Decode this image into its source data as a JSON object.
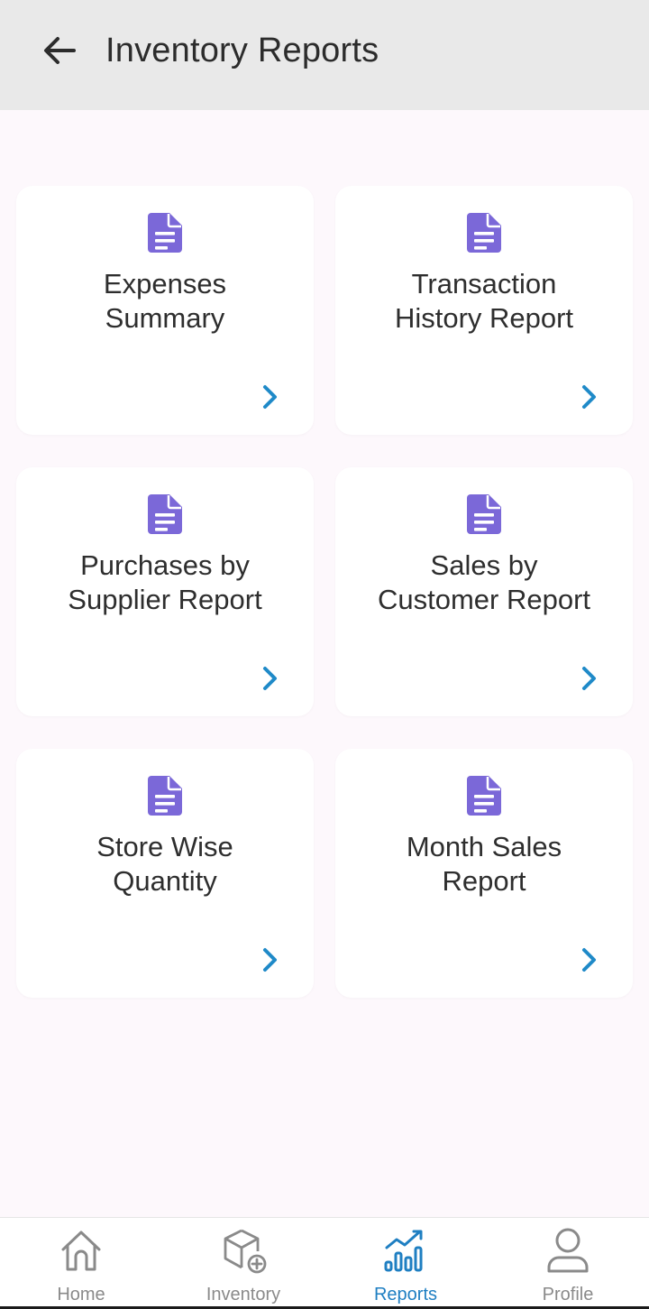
{
  "header": {
    "title": "Inventory Reports",
    "back_icon": "arrow-left-icon"
  },
  "colors": {
    "header_bg": "#e9e9e9",
    "page_bg": "#fdf8fc",
    "card_bg": "#ffffff",
    "doc_icon": "#7b68d8",
    "arrow": "#1f8ac8",
    "nav_active": "#1f7fc2",
    "nav_inactive": "#8a8a8a"
  },
  "reports": [
    {
      "title": "Expenses\nSummary",
      "icon": "document-icon",
      "action_icon": "chevron-right-icon"
    },
    {
      "title": "Transaction\nHistory Report",
      "icon": "document-icon",
      "action_icon": "chevron-right-icon"
    },
    {
      "title": "Purchases by\nSupplier Report",
      "icon": "document-icon",
      "action_icon": "chevron-right-icon"
    },
    {
      "title": "Sales by\nCustomer Report",
      "icon": "document-icon",
      "action_icon": "chevron-right-icon"
    },
    {
      "title": "Store Wise\nQuantity",
      "icon": "document-icon",
      "action_icon": "chevron-right-icon"
    },
    {
      "title": "Month Sales\nReport",
      "icon": "document-icon",
      "action_icon": "chevron-right-icon"
    }
  ],
  "nav": {
    "items": [
      {
        "label": "Home",
        "icon": "home-icon",
        "active": false
      },
      {
        "label": "Inventory",
        "icon": "box-add-icon",
        "active": false
      },
      {
        "label": "Reports",
        "icon": "bar-chart-icon",
        "active": true
      },
      {
        "label": "Profile",
        "icon": "user-icon",
        "active": false
      }
    ]
  }
}
